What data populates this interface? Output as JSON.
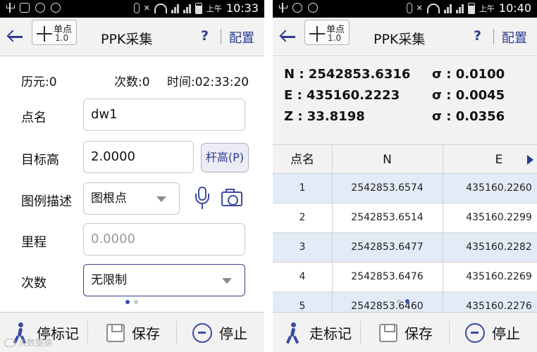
{
  "left": {
    "status": {
      "am": "上午",
      "time": "10:33"
    },
    "title": {
      "mode_label": "单点",
      "mode_version": "1.0",
      "app_title": "PPK采集",
      "help": "?",
      "config": "配置"
    },
    "info": {
      "epoch": "历元:0",
      "count": "次数:0",
      "time": "时间:02:33:20"
    },
    "form": {
      "point_name_label": "点名",
      "point_name_value": "dw1",
      "target_height_label": "目标高",
      "target_height_value": "2.0000",
      "pole_height_button": "杆高(P)",
      "legend_label": "图例描述",
      "legend_value": "图根点",
      "mileage_label": "里程",
      "mileage_placeholder": "0.0000",
      "times_label": "次数",
      "times_value": "无限制"
    },
    "bottom": {
      "walk": "停标记",
      "save": "保存",
      "stop": "停止"
    }
  },
  "right": {
    "status": {
      "am": "上午",
      "time": "10:40"
    },
    "title": {
      "mode_label": "单点",
      "mode_version": "1.0",
      "app_title": "PPK采集",
      "help": "?",
      "config": "配置"
    },
    "coords": [
      {
        "label": "N : 2542853.6316",
        "sigma": "σ : 0.0100"
      },
      {
        "label": "E : 435160.2223",
        "sigma": "σ : 0.0045"
      },
      {
        "label": "Z : 33.8198",
        "sigma": "σ : 0.0356"
      }
    ],
    "table": {
      "headers": [
        "点名",
        "N",
        "E"
      ],
      "rows": [
        [
          "1",
          "2542853.6574",
          "435160.2260"
        ],
        [
          "2",
          "2542853.6514",
          "435160.2299"
        ],
        [
          "3",
          "2542853.6477",
          "435160.2282"
        ],
        [
          "4",
          "2542853.6476",
          "435160.2269"
        ],
        [
          "5",
          "2542853.6460",
          "435160.2276"
        ]
      ]
    },
    "bottom": {
      "walk": "走标记",
      "save": "保存",
      "stop": "停止"
    }
  },
  "watermark": "大数据猿"
}
